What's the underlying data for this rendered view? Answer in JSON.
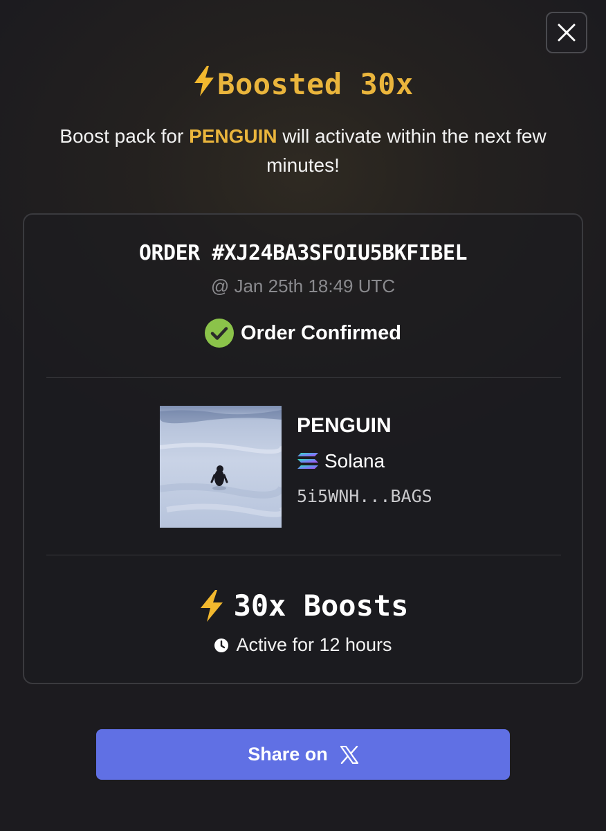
{
  "headline": {
    "icon": "lightning-bolt-icon",
    "text": "Boosted 30x",
    "color": "#eab53c"
  },
  "subtitle": {
    "prefix": "Boost pack for ",
    "token": "PENGUIN",
    "suffix": " will activate within the next few minutes!"
  },
  "order": {
    "id": "ORDER #XJ24BA3SFOIU5BKFIBEL",
    "date": "@ Jan 25th 18:49 UTC",
    "status": "Order Confirmed",
    "status_icon": "check-circle-icon",
    "status_color": "#8bc34a"
  },
  "token": {
    "name": "PENGUIN",
    "chain": "Solana",
    "chain_icon": "solana-logo-icon",
    "address": "5i5WNH...BAGS",
    "image": "penguin-photo"
  },
  "boost": {
    "icon": "lightning-bolt-icon",
    "label": "30x Boosts",
    "duration_icon": "clock-icon",
    "duration": "Active for 12 hours"
  },
  "share_button": {
    "label": "Share on",
    "icon": "x-logo-icon",
    "color": "#6070e4"
  },
  "close_button": {
    "icon": "close-icon"
  }
}
